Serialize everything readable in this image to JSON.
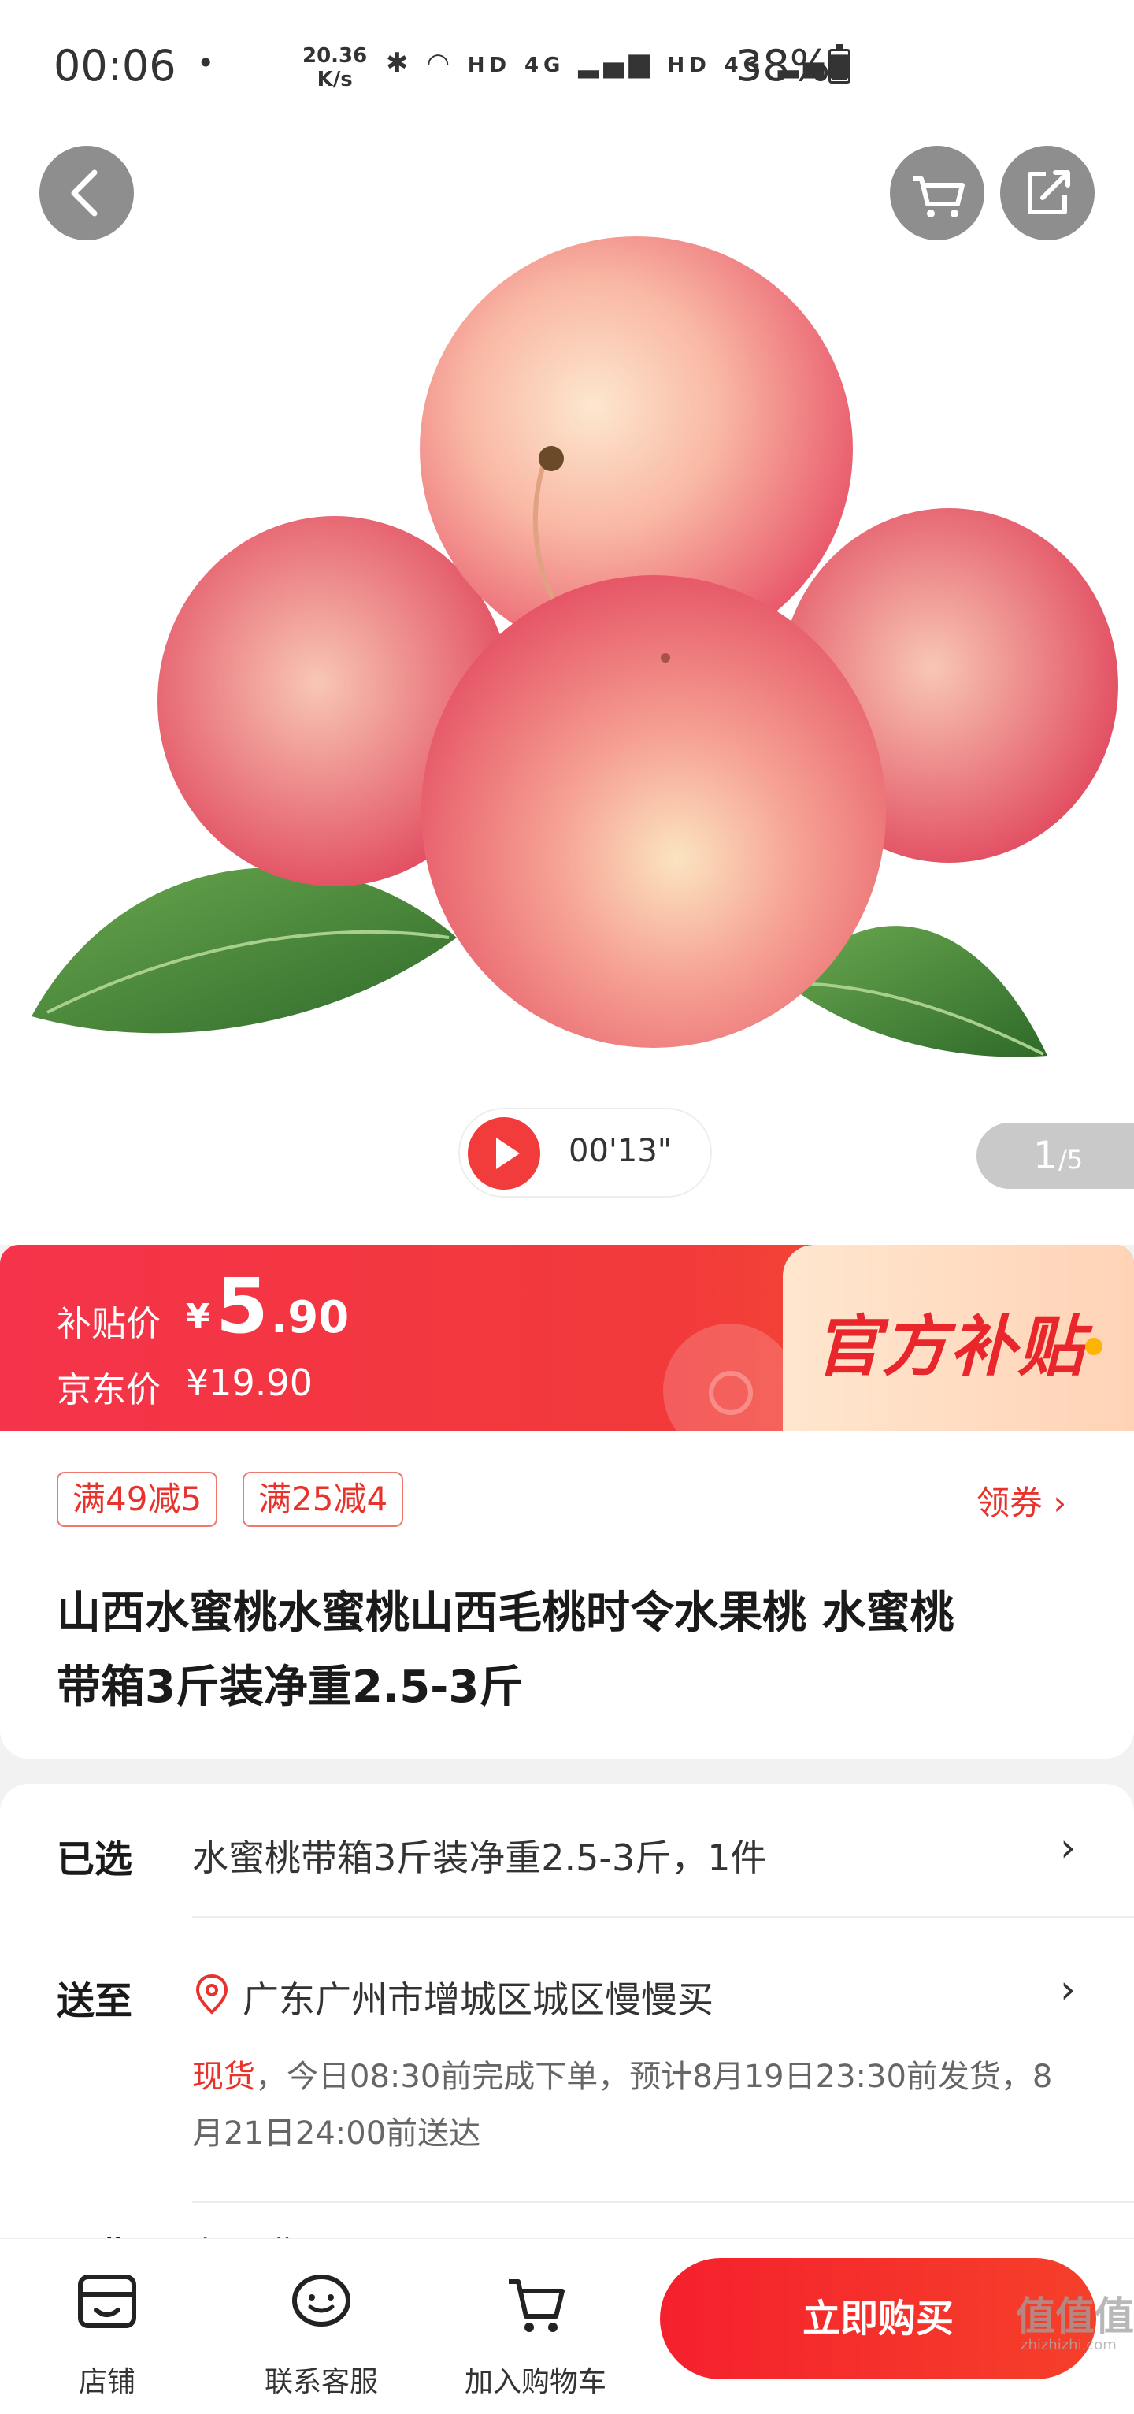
{
  "status_bar": {
    "time": "00:06",
    "dot": "•",
    "net_speed_value": "20.36",
    "net_speed_unit": "K/s",
    "hd_1": "HD",
    "net_1": "4G",
    "hd_2": "HD",
    "net_2": "4G",
    "battery": "38%",
    "battery_level": 0.38
  },
  "gallery": {
    "video_time": "00'13\"",
    "page_current": "1",
    "page_total": "/5"
  },
  "price": {
    "subsidy_label": "补贴价",
    "currency": "¥",
    "integer": "5",
    "decimal": ".90",
    "jd_label": "京东价",
    "jd_price": "¥19.90",
    "badge": "官方补贴"
  },
  "coupons": [
    "满49减5",
    "满25减4"
  ],
  "coupon_link": "领券 ›",
  "product": {
    "title_line1": "山西水蜜桃水蜜桃山西毛桃时令水果桃 水蜜桃",
    "title_line2": "带箱3斤装净重2.5-3斤"
  },
  "selected": {
    "label": "已选",
    "value": "水蜜桃带箱3斤装净重2.5-3斤，1件"
  },
  "delivery": {
    "label": "送至",
    "address": "广东广州市增城区城区慢慢买",
    "stock": "现货",
    "note": "，今日08:30前完成下单，预计8月19日23:30前发货，8月21日24:00前送达"
  },
  "shipping": {
    "label": "运费",
    "value": "免运费"
  },
  "chevron": "›",
  "bottom_bar": {
    "store": "店铺",
    "service": "联系客服",
    "cart": "加入购物车",
    "buy": "立即购买"
  },
  "watermark": {
    "text": "值值值",
    "url": "zhizhizhi.com"
  },
  "colors": {
    "accent_red": "#f23a3a",
    "coupon_red": "#e8332d",
    "subsidy_bg": "#ffe0c8"
  }
}
